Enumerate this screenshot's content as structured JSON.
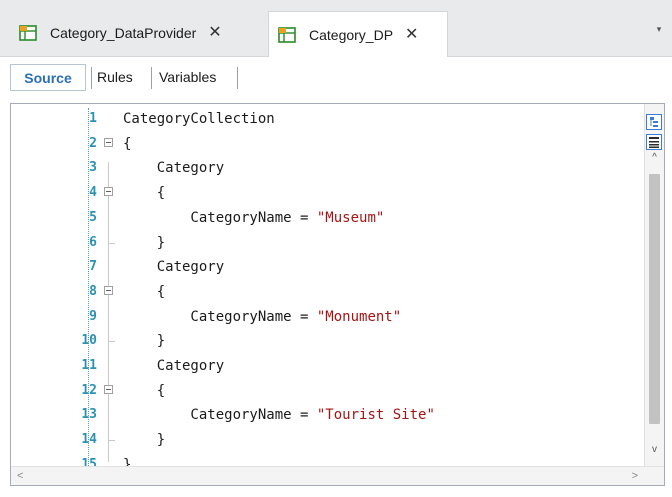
{
  "tabs": [
    {
      "label": "Category_DataProvider",
      "close": "✕",
      "active": false,
      "icon": "data-provider-icon"
    },
    {
      "label": "Category_DP",
      "close": "✕",
      "active": true,
      "icon": "data-provider-icon"
    }
  ],
  "tab_overflow": "▾",
  "subtabs": {
    "source": "Source",
    "rules": "Rules",
    "variables": "Variables"
  },
  "editor": {
    "lines": [
      {
        "n": "1",
        "code": "CategoryCollection"
      },
      {
        "n": "2",
        "code": "{"
      },
      {
        "n": "3",
        "code": "    Category"
      },
      {
        "n": "4",
        "code": "    {"
      },
      {
        "n": "5",
        "code": "        CategoryName = ",
        "str": "\"Museum\""
      },
      {
        "n": "6",
        "code": "    }"
      },
      {
        "n": "7",
        "code": "    Category"
      },
      {
        "n": "8",
        "code": "    {"
      },
      {
        "n": "9",
        "code": "        CategoryName = ",
        "str": "\"Monument\""
      },
      {
        "n": "10",
        "code": "    }"
      },
      {
        "n": "11",
        "code": "    Category"
      },
      {
        "n": "12",
        "code": "    {"
      },
      {
        "n": "13",
        "code": "        CategoryName = ",
        "str": "\"Tourist Site\""
      },
      {
        "n": "14",
        "code": "    }"
      },
      {
        "n": "15",
        "code": "}"
      }
    ]
  },
  "scroll": {
    "up": "^",
    "down": "v",
    "left": "<",
    "right": ">"
  },
  "colors": {
    "line_number": "#2b91af",
    "string": "#a31515",
    "accent": "#2b6fb6"
  }
}
